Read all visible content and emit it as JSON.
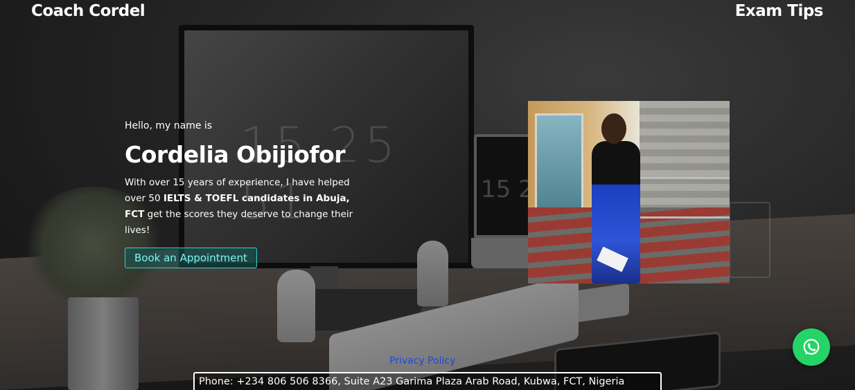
{
  "header": {
    "brand": "Coach Cordel",
    "nav_link": "Exam Tips"
  },
  "intro": {
    "greeting": "Hello, my name is",
    "name": "Cordelia Obijiofor",
    "bio_part1": "With over 15 years of experience, I have helped over 50 ",
    "bio_bold": "IELTS & TOEFL candidates in Abuja, FCT",
    "bio_part2": " get the scores they deserve to change their lives!",
    "cta_label": "Book an Appointment"
  },
  "background": {
    "clock_text": "15 25 51",
    "laptop_text": "15 2"
  },
  "footer": {
    "privacy_label": "Privacy Policy",
    "contact": "Phone: +234 806 506 8366, Suite A23 Garima Plaza Arab Road, Kubwa, FCT, Nigeria"
  },
  "colors": {
    "accent": "#35d3c9",
    "whatsapp": "#25d366",
    "privacy_link": "#1f49d6"
  },
  "icons": {
    "whatsapp": "whatsapp-icon"
  }
}
